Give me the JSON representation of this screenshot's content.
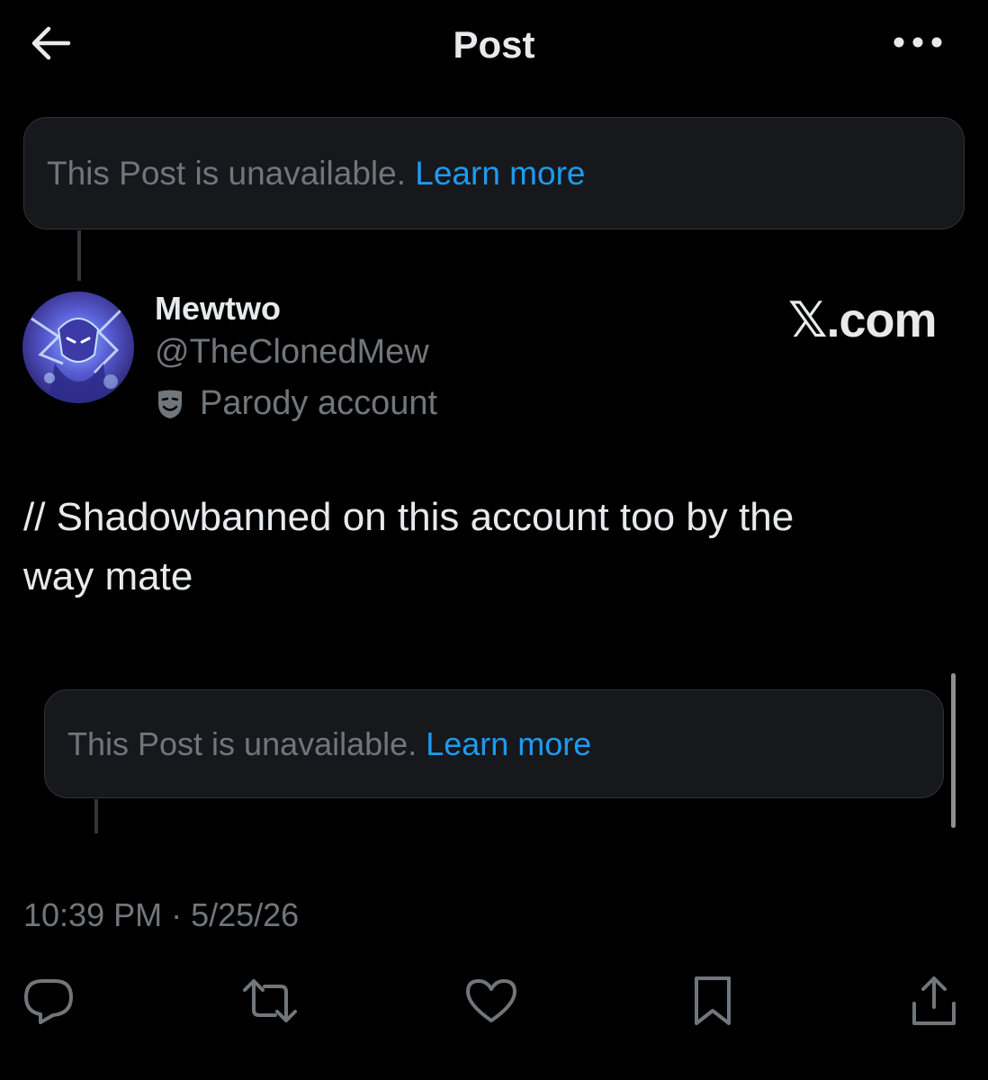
{
  "header": {
    "title": "Post",
    "back_icon": "arrow-left-icon",
    "more_icon": "more-horizontal-icon"
  },
  "parent_post": {
    "text": "This Post is unavailable.",
    "link": "Learn more"
  },
  "author": {
    "display_name": "Mewtwo",
    "handle": "@TheClonedMew",
    "label": "Parody account",
    "label_icon": "theater-mask-icon"
  },
  "watermark": "𝕏.com",
  "post": {
    "text_line1": "// Shadowbanned on this account too by the",
    "text_line2": "way mate"
  },
  "quoted_post": {
    "text": "This Post is unavailable.",
    "link": "Learn more"
  },
  "meta": {
    "timestamp": "10:39 PM · 5/25/26"
  },
  "actions": [
    {
      "name": "reply",
      "icon": "reply-icon"
    },
    {
      "name": "repost",
      "icon": "repost-icon"
    },
    {
      "name": "like",
      "icon": "heart-icon"
    },
    {
      "name": "bookmark",
      "icon": "bookmark-icon"
    },
    {
      "name": "share",
      "icon": "share-icon"
    }
  ],
  "colors": {
    "background": "#000000",
    "text_primary": "#e7e9ea",
    "text_secondary": "#71767b",
    "link": "#1d9bf0",
    "card_bg": "#16181c",
    "border": "#2f3336"
  }
}
